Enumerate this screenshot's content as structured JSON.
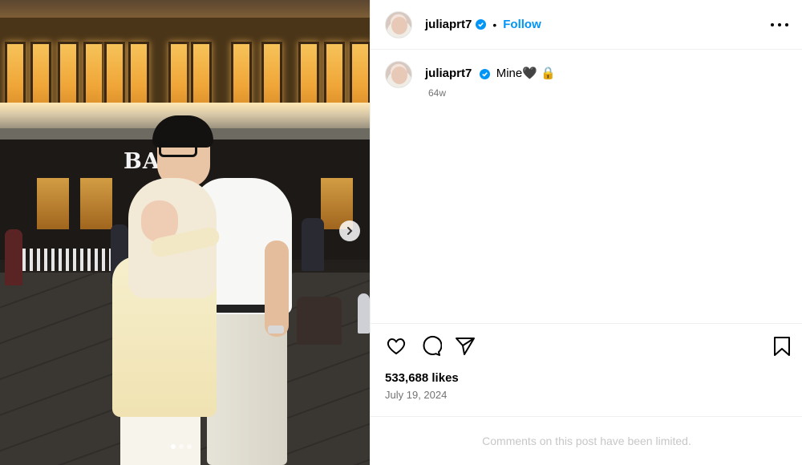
{
  "post": {
    "username": "juliaprt7",
    "separator": "•",
    "follow_label": "Follow",
    "caption": "Mine",
    "caption_emoji_heart": "🖤",
    "caption_emoji_lock": "🔒",
    "time_ago": "64w",
    "likes": "533,688 likes",
    "date": "July 19, 2024",
    "comments_notice": "Comments on this post have been limited."
  },
  "photo": {
    "sign_text": "BATA",
    "carousel_dots": 3,
    "active_dot": 0
  },
  "icons": {
    "verified": "verified-badge-icon",
    "more": "more-options-icon",
    "like": "heart-icon",
    "comment": "comment-icon",
    "share": "share-icon",
    "save": "bookmark-icon",
    "next": "chevron-right-icon"
  },
  "colors": {
    "accent": "#0095f6",
    "muted_text": "#737373",
    "limited_text": "#c7c7c7"
  }
}
